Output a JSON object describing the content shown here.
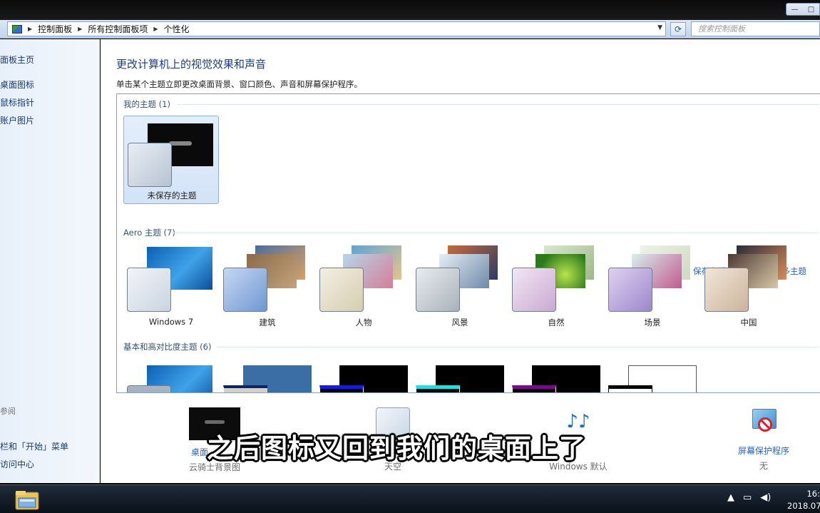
{
  "window": {
    "minimize_label": "—",
    "restore_label": "□"
  },
  "address": {
    "crumbs": [
      "控制面板",
      "所有控制面板项",
      "个性化"
    ],
    "search_placeholder": "搜索控制面板"
  },
  "nav": {
    "items": [
      "面板主页",
      "桌面图标",
      "鼠标指针",
      "账户图片"
    ],
    "see_also": "参阅",
    "bottom_links": [
      "栏和「开始」菜单",
      "访问中心"
    ]
  },
  "main": {
    "title": "更改计算机上的视觉效果和声音",
    "subtitle": "单击某个主题立即更改桌面背景、窗口颜色、声音和屏幕保护程序。",
    "groups": {
      "my": {
        "heading": "我的主题 (1)",
        "themes": [
          {
            "label": "未保存的主题"
          }
        ]
      },
      "aero": {
        "heading": "Aero 主题 (7)",
        "themes": [
          {
            "label": "Windows 7"
          },
          {
            "label": "建筑"
          },
          {
            "label": "人物"
          },
          {
            "label": "风景"
          },
          {
            "label": "自然"
          },
          {
            "label": "场景"
          },
          {
            "label": "中国"
          }
        ]
      },
      "basic": {
        "heading": "基本和高对比度主题 (6)"
      }
    },
    "links": {
      "save": "保存主题",
      "online": "联机获取更多主题"
    }
  },
  "bottom": {
    "desktop_bg": {
      "label": "桌面",
      "value": "云骑士背景图"
    },
    "window_color": {
      "value": "天空"
    },
    "sound": {
      "value": "Windows 默认"
    },
    "screensaver": {
      "label": "屏幕保护程序",
      "value": "无"
    }
  },
  "caption": "之后图标又回到我们的桌面上了",
  "taskbar": {
    "time": "16:",
    "date": "2018.07"
  }
}
